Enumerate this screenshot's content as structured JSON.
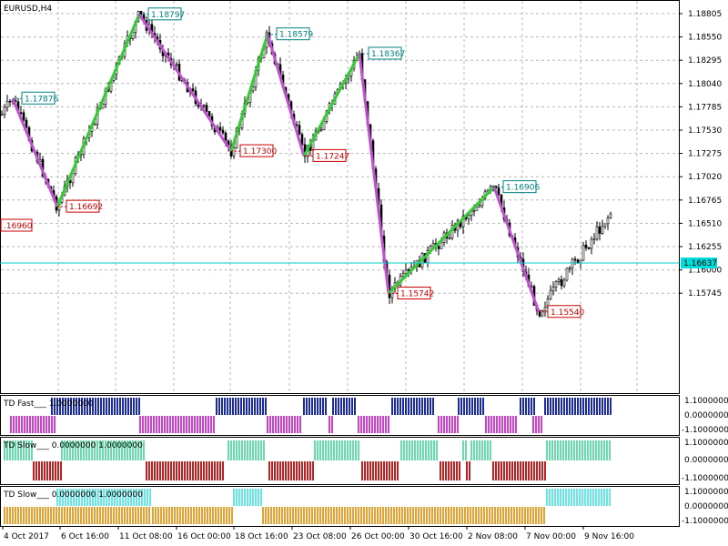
{
  "window": {
    "title": "EURUSD,H4",
    "current_price": "1.16637"
  },
  "chart_data": {
    "type": "line",
    "symbol": "EURUSD",
    "timeframe": "H4",
    "price_scale": [
      "1.18805",
      "1.18550",
      "1.18295",
      "1.18040",
      "1.17785",
      "1.17530",
      "1.17275",
      "1.17020",
      "1.16765",
      "1.16510",
      "1.16255",
      "1.16000",
      "1.15745"
    ],
    "time_labels": [
      "4 Oct 2017",
      "6 Oct 16:00",
      "11 Oct 08:00",
      "16 Oct 00:00",
      "18 Oct 16:00",
      "23 Oct 08:00",
      "26 Oct 00:00",
      "30 Oct 16:00",
      "2 Nov 08:00",
      "7 Nov 00:00",
      "9 Nov 16:00"
    ],
    "zigzag": [
      {
        "label": "1.17876",
        "type": "high",
        "value": 1.17876
      },
      {
        "label": "1.16692",
        "type": "low",
        "value": 1.16692
      },
      {
        "label": "1.18797",
        "type": "high",
        "value": 1.18797
      },
      {
        "label": "1.17300",
        "type": "low",
        "value": 1.173
      },
      {
        "label": "1.18579",
        "type": "high",
        "value": 1.18579
      },
      {
        "label": "1.17247",
        "type": "low",
        "value": 1.17247
      },
      {
        "label": "1.18367",
        "type": "high",
        "value": 1.18367
      },
      {
        "label": "1.15742",
        "type": "low",
        "value": 1.15742
      },
      {
        "label": "1.16906",
        "type": "high",
        "value": 1.16906
      },
      {
        "label": "1.15540",
        "type": "low",
        "value": 1.1554
      }
    ],
    "left_edge_label": ".16960",
    "colors": {
      "up_segment": "#33cc33",
      "down_segment": "#c050d0",
      "high_tag": "#008080",
      "low_tag": "#cc0000",
      "current_line": "#00cccc"
    }
  },
  "indicators": [
    {
      "name": "TD Fast",
      "title": "TD Fast___ 1.0000000",
      "scale": [
        "1.1000000",
        "0.0000000",
        "-1.1000000"
      ],
      "color_up": "#1a2aa8",
      "color_down": "#d040d0"
    },
    {
      "name": "TD Slow 1",
      "title": "TD Slow___ 0.0000000 1.0000000",
      "scale": [
        "1.1000000",
        "0.0000000",
        "-1.1000000"
      ],
      "color_up": "#66ddaa",
      "color_down": "#c02020"
    },
    {
      "name": "TD Slow 2",
      "title": "TD Slow___ 0.0000000 1.0000000",
      "scale": [
        "1.1000000",
        "0.0000000",
        "-1.1000000"
      ],
      "color_up": "#66e8e8",
      "color_down": "#e8a030"
    }
  ]
}
